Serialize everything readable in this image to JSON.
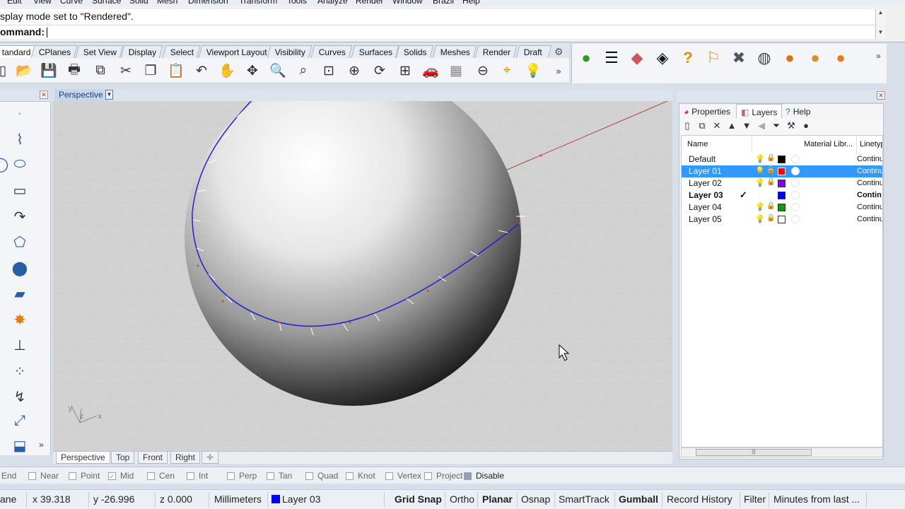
{
  "menu": [
    "Edit",
    "View",
    "Curve",
    "Surface",
    "Solid",
    "Mesh",
    "Dimension",
    "Transform",
    "Tools",
    "Analyze",
    "Render",
    "Window",
    "Brazil",
    "Help"
  ],
  "command": {
    "history": "splay mode set to \"Rendered\".",
    "prompt": "ommand:"
  },
  "toolbar_tabs": [
    "tandard",
    "CPlanes",
    "Set View",
    "Display",
    "Select",
    "Viewport Layout",
    "Visibility",
    "Curves",
    "Surfaces",
    "Solids",
    "Meshes",
    "Render",
    "Draft"
  ],
  "toolbar_icons": [
    "new-icon",
    "open-icon",
    "save-icon",
    "print-icon",
    "import-icon",
    "cut-icon",
    "copy-icon",
    "paste-icon",
    "undo-icon",
    "pan-icon",
    "rotate-view-icon",
    "zoom-icon",
    "zoom-window-icon",
    "zoom-extents-icon",
    "zoom-selected-icon",
    "rotate-icon",
    "four-viewports-icon",
    "car-icon",
    "grid-icon",
    "osnap-icon",
    "gumball-icon",
    "light-bulb-icon"
  ],
  "render_icons": [
    "sphere-green-icon",
    "layer-list-icon",
    "diamond-icon",
    "diamond-outline-icon",
    "help-icon",
    "properties-icon",
    "tools-icon",
    "sphere-grey-icon",
    "sphere-orange-icon",
    "material-icon",
    "material-dots-icon"
  ],
  "viewport": {
    "title": "Perspective",
    "tabs": [
      "Perspective",
      "Top",
      "Front",
      "Right"
    ],
    "axis_labels": {
      "y": "y",
      "z": "z",
      "x": "x"
    }
  },
  "panel": {
    "tabs": [
      "Properties",
      "Layers",
      "Help"
    ],
    "active_tab": "Layers",
    "columns": [
      "Name",
      "Material Libr...",
      "Linetyp"
    ],
    "layers": [
      {
        "name": "Default",
        "color": "#000000",
        "linetype": "Continu",
        "selected": false,
        "current": false
      },
      {
        "name": "Layer 01",
        "color": "#ff0000",
        "linetype": "Continu",
        "selected": true,
        "current": false
      },
      {
        "name": "Layer 02",
        "color": "#8000ff",
        "linetype": "Continu",
        "selected": false,
        "current": false
      },
      {
        "name": "Layer 03",
        "color": "#0000ff",
        "linetype": "Contin",
        "selected": false,
        "current": true
      },
      {
        "name": "Layer 04",
        "color": "#00a000",
        "linetype": "Continu",
        "selected": false,
        "current": false
      },
      {
        "name": "Layer 05",
        "color": "#ffffff",
        "linetype": "Continu",
        "selected": false,
        "current": false
      }
    ]
  },
  "osnap": [
    {
      "label": "End",
      "checked": false
    },
    {
      "label": "Near",
      "checked": false
    },
    {
      "label": "Point",
      "checked": false
    },
    {
      "label": "Mid",
      "checked": true
    },
    {
      "label": "Cen",
      "checked": false
    },
    {
      "label": "Int",
      "checked": false
    },
    {
      "label": "Perp",
      "checked": false
    },
    {
      "label": "Tan",
      "checked": false
    },
    {
      "label": "Quad",
      "checked": false
    },
    {
      "label": "Knot",
      "checked": false
    },
    {
      "label": "Vertex",
      "checked": false
    },
    {
      "label": "Project",
      "checked": false
    },
    {
      "label": "Disable",
      "checked": false
    }
  ],
  "status": {
    "plane": "ane",
    "x": "x 39.318",
    "y": "y -26.996",
    "z": "z 0.000",
    "units": "Millimeters",
    "layer": "Layer 03",
    "layer_color": "#0000ff",
    "buttons": [
      "Grid Snap",
      "Ortho",
      "Planar",
      "Osnap",
      "SmartTrack",
      "Gumball",
      "Record History",
      "Filter",
      "Minutes from last ..."
    ],
    "bold_buttons": [
      "Grid Snap",
      "Planar",
      "Gumball"
    ]
  }
}
